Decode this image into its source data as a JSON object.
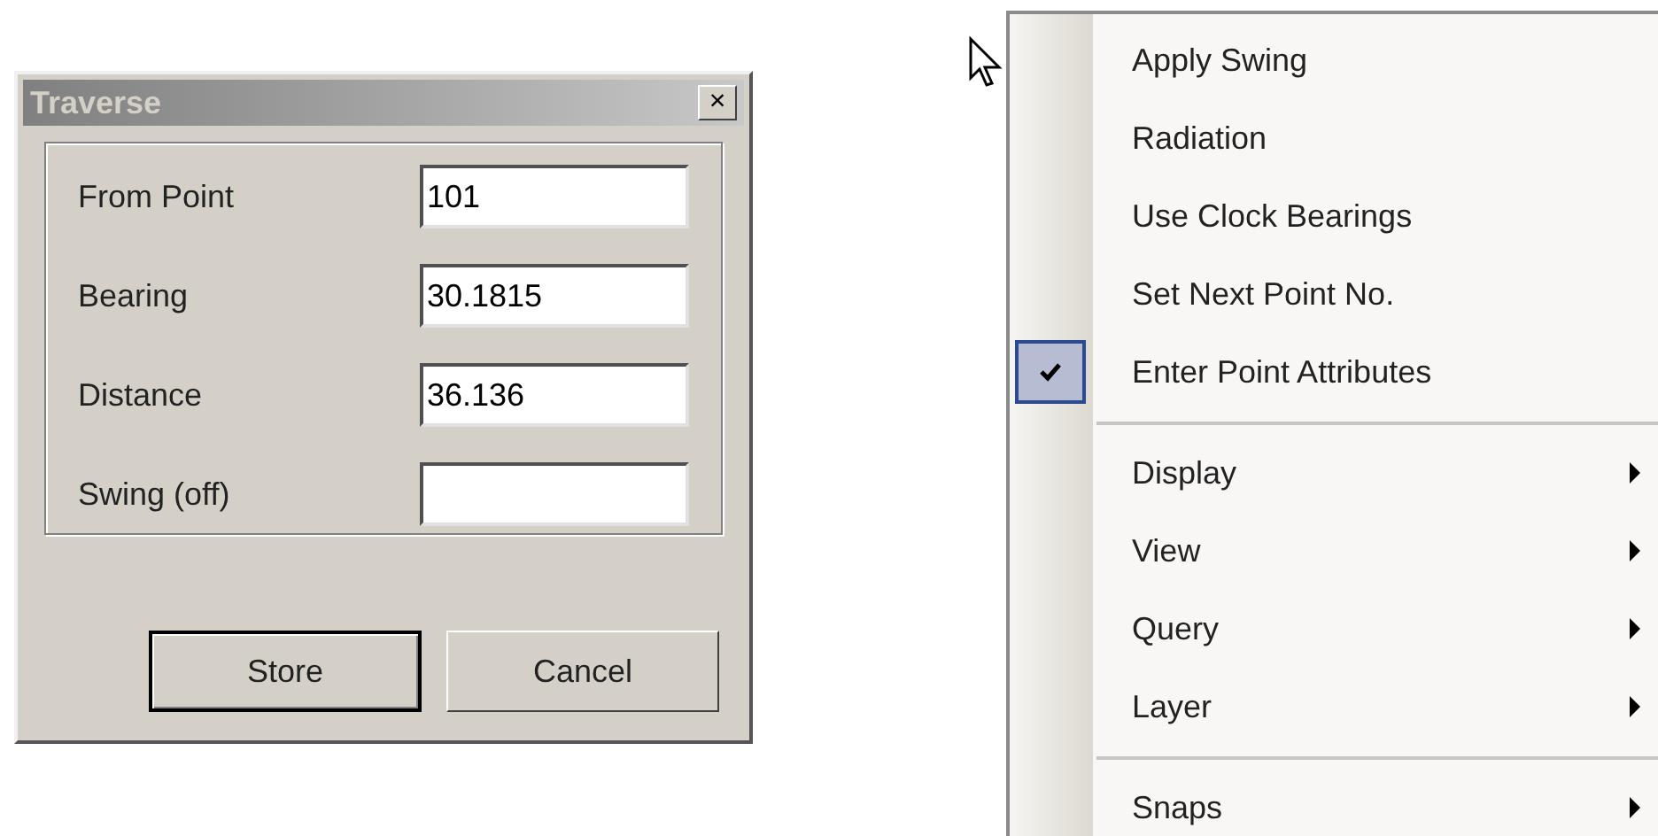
{
  "dialog": {
    "title": "Traverse",
    "close": "×",
    "fields": [
      {
        "label": "From Point",
        "value": "101"
      },
      {
        "label": "Bearing",
        "value": "30.1815"
      },
      {
        "label": "Distance",
        "value": "36.136"
      },
      {
        "label": "Swing (off)"
      }
    ],
    "buttons": [
      {
        "label": "Store",
        "default": true
      },
      {
        "label": "Cancel",
        "default": false
      }
    ]
  },
  "context_menu": {
    "entries": [
      {
        "kind": "item",
        "label": "Apply Swing",
        "checked": false,
        "submenu": false
      },
      {
        "kind": "item",
        "label": "Radiation",
        "checked": false,
        "submenu": false
      },
      {
        "kind": "item",
        "label": "Use Clock Bearings",
        "checked": false,
        "submenu": false
      },
      {
        "kind": "item",
        "label": "Set Next Point No.",
        "checked": false,
        "submenu": false
      },
      {
        "kind": "item",
        "label": "Enter Point Attributes",
        "checked": true,
        "submenu": false
      },
      {
        "kind": "separator"
      },
      {
        "kind": "item",
        "label": "Display",
        "checked": false,
        "submenu": true
      },
      {
        "kind": "item",
        "label": "View",
        "checked": false,
        "submenu": true
      },
      {
        "kind": "item",
        "label": "Query",
        "checked": false,
        "submenu": true
      },
      {
        "kind": "item",
        "label": "Layer",
        "checked": false,
        "submenu": true
      },
      {
        "kind": "separator"
      },
      {
        "kind": "item",
        "label": "Snaps",
        "checked": false,
        "submenu": true
      }
    ]
  }
}
